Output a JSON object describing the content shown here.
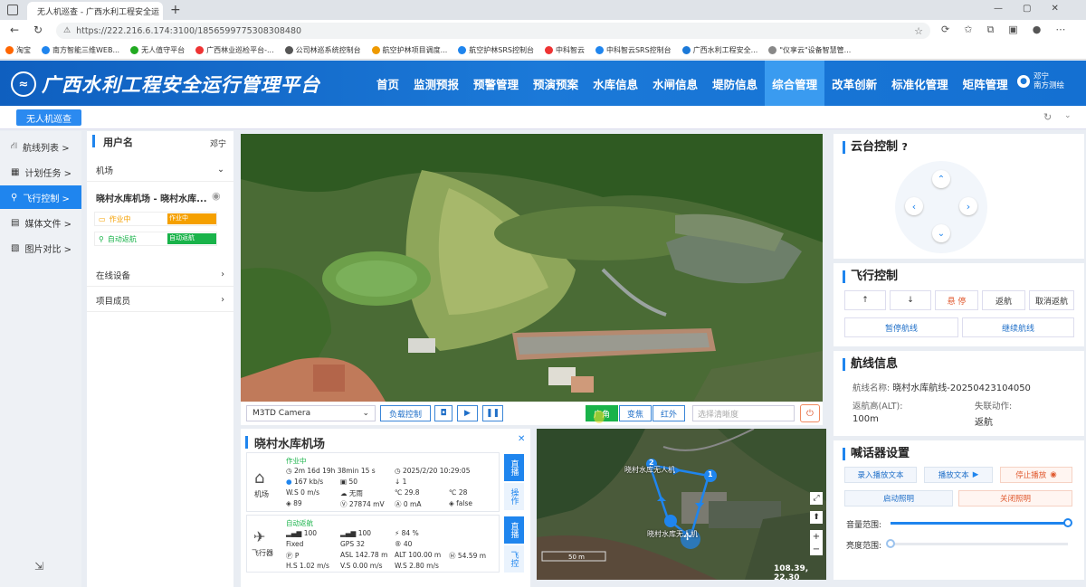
{
  "browser": {
    "tab_title": "无人机巡查 - 广西水利工程安全运",
    "url": "https://222.216.6.174:3100/1856599775308308480",
    "bookmarks": [
      "淘宝",
      "南方智能三维WEB...",
      "无人值守平台",
      "广西林业巡检平台-...",
      "公司林巡系统控制台",
      "航空护林项目调度...",
      "航空护林SRS控制台",
      "中科智云",
      "中科智云SRS控制台",
      "广西水利工程安全...",
      "\"仪享云\"设备智慧管..."
    ]
  },
  "header": {
    "title": "广西水利工程安全运行管理平台",
    "nav": [
      "首页",
      "监测预报",
      "预警管理",
      "预演预案",
      "水库信息",
      "水闸信息",
      "堤防信息",
      "综合管理",
      "改革创新",
      "标准化管理",
      "矩阵管理"
    ],
    "active_nav": "综合管理",
    "user_name": "邓宁",
    "user_org": "南方测绘"
  },
  "subbar": {
    "tab": "无人机巡查"
  },
  "leftmenu": {
    "items": [
      {
        "label": "航线列表 >",
        "icon": "route-icon"
      },
      {
        "label": "计划任务 >",
        "icon": "calendar-icon"
      },
      {
        "label": "飞行控制 >",
        "icon": "drone-icon"
      },
      {
        "label": "媒体文件 >",
        "icon": "media-icon"
      },
      {
        "label": "图片对比 >",
        "icon": "image-icon"
      }
    ]
  },
  "devpanel": {
    "username_label": "用户名",
    "username_value": "邓宁",
    "airport_section": "机场",
    "airport_name": "晓村水库机场 - 晓村水库...",
    "status1": "作业中",
    "status2": "自动返航",
    "bar1": "作业中",
    "bar2": "自动返航",
    "online_devices": "在线设备",
    "project_members": "项目成员"
  },
  "videobar": {
    "camera": "M3TD Camera",
    "payload_btn": "负载控制",
    "wide": "广角",
    "zoom": "变焦",
    "infrared": "红外",
    "clarity_placeholder": "选择清晰度"
  },
  "infopanel": {
    "title": "晓村水库机场",
    "dock": {
      "label": "机场",
      "status": "作业中",
      "time": "2m 16d 19h 38min 15 s",
      "date": "2025/2/20 10:29:05",
      "speed": "167 kb/s",
      "v1": "50",
      "v2": "1",
      "ws": "W.S  0 m/s",
      "weather": "无雨",
      "temp1": "29.8",
      "temp2": "28",
      "humidity": "89",
      "voltage": "27874 mV",
      "current": "0 mA",
      "flag": "false",
      "side_btn1": "直播",
      "side_btn2": "操作"
    },
    "aircraft": {
      "label": "飞行器",
      "status": "自动返航",
      "sig1": "100",
      "sig2": "100",
      "battery": "84 %",
      "mode": "Fixed",
      "gps": "GPS  32",
      "sats": "40",
      "p": "P",
      "asl": "ASL  142.78 m",
      "alt": "ALT  100.00 m",
      "h": "54.59 m",
      "hs": "H.S  1.02 m/s",
      "vs": "V.S  0.00 m/s",
      "ws": "W.S  2.80 m/s",
      "side_btn1": "直播",
      "side_btn2": "飞控"
    }
  },
  "map": {
    "label_dock": "晓村水库无人机",
    "label_dock2": "晓村水库无人机",
    "wp1": "1",
    "wp2": "2",
    "scale": "50 m",
    "coords": "108.39, 22.30"
  },
  "gimbal": {
    "title": "云台控制"
  },
  "flight": {
    "title": "飞行控制",
    "up": "↑",
    "down": "↓",
    "hover": "悬 停",
    "return": "返航",
    "cancel_return": "取消返航",
    "pause_route": "暂停航线",
    "resume_route": "继续航线"
  },
  "route": {
    "title": "航线信息",
    "name_label": "航线名称:",
    "name_value": "晓村水库航线-20250423104050",
    "rth_label": "返航高(ALT):",
    "rth_value": "100m",
    "lost_label": "失联动作:",
    "lost_value": "返航"
  },
  "speaker": {
    "title": "喊话器设置",
    "record": "录入播放文本",
    "play": "播放文本",
    "stop": "停止播放",
    "light_on": "启动照明",
    "light_off": "关闭照明",
    "volume": "音量范围:",
    "brightness": "亮度范围:",
    "volume_level": 1.0,
    "brightness_level": 0.0
  },
  "colors": {
    "brand": "#1b79d8",
    "accent": "#1f85ee",
    "orange": "#f5a000",
    "green": "#19b34a"
  }
}
